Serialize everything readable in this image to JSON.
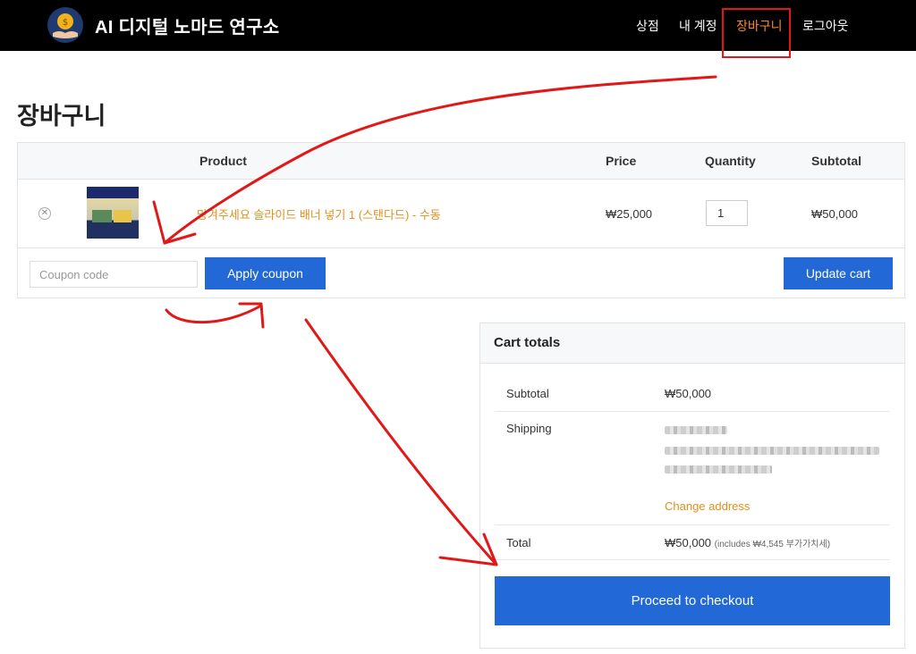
{
  "header": {
    "site_title": "AI 디지털 노마드 연구소",
    "nav": [
      {
        "label": "상점",
        "active": false
      },
      {
        "label": "내 계정",
        "active": false
      },
      {
        "label": "장바구니",
        "active": true
      },
      {
        "label": "로그아웃",
        "active": false
      }
    ],
    "colors": {
      "background": "#000000",
      "active": "#ff8a1e"
    },
    "logo_icon": "coin-hand-icon"
  },
  "page": {
    "title": "장바구니"
  },
  "cart": {
    "columns": {
      "product": "Product",
      "price": "Price",
      "quantity": "Quantity",
      "subtotal": "Subtotal"
    },
    "items": [
      {
        "name": "망겨주세요 슬라이드 배너 넣기 1 (스탠다드) - 수동",
        "price": "₩25,000",
        "quantity": "1",
        "subtotal": "₩50,000"
      }
    ],
    "coupon_placeholder": "Coupon code",
    "apply_coupon": "Apply coupon",
    "update_cart": "Update cart"
  },
  "totals": {
    "title": "Cart totals",
    "subtotal_label": "Subtotal",
    "subtotal_value": "₩50,000",
    "shipping_label": "Shipping",
    "change_address": "Change address",
    "total_label": "Total",
    "total_value": "₩50,000",
    "tax_note": "(includes ₩4,545 부가가치세)",
    "checkout": "Proceed to checkout"
  },
  "colors": {
    "primary_button": "#2268d6",
    "link": "#e0901c",
    "annotation": "#e01818"
  }
}
